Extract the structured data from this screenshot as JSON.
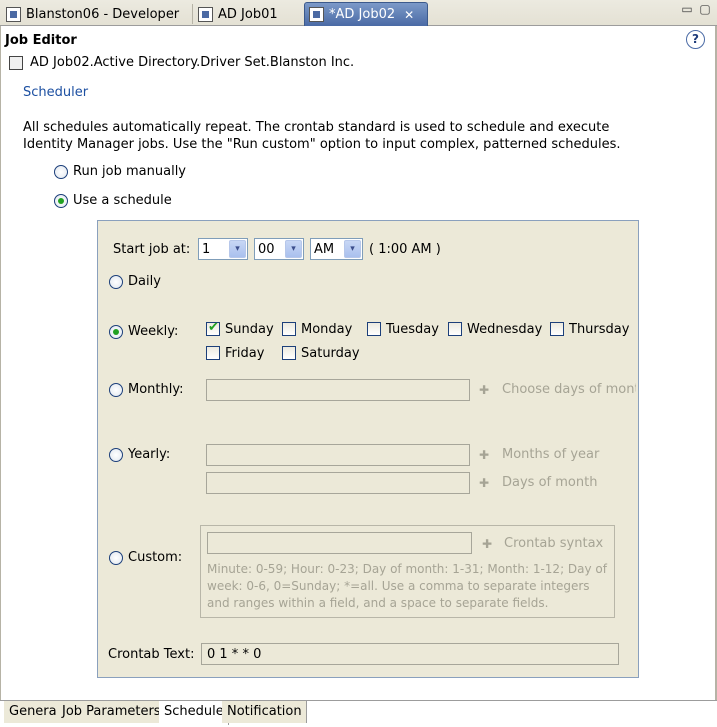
{
  "tabs": [
    {
      "label": "Blanston06 - Developer"
    },
    {
      "label": "AD Job01"
    },
    {
      "label": "*AD Job02",
      "active": true
    }
  ],
  "header": {
    "title": "Job Editor",
    "help_symbol": "?",
    "object_path": "AD Job02.Active Directory.Driver Set.Blanston Inc."
  },
  "section": {
    "link": "Scheduler",
    "description": "All schedules automatically repeat. The crontab standard is used to schedule and execute Identity Manager jobs. Use the \"Run custom\" option to input complex, patterned schedules."
  },
  "mode": {
    "run_manually": "Run job manually",
    "use_schedule": "Use a schedule",
    "selected": "use_schedule"
  },
  "schedule": {
    "start_label": "Start job at:",
    "hour": "1",
    "minute": "00",
    "ampm": "AM",
    "time_display": "( 1:00 AM )",
    "daily_label": "Daily",
    "weekly_label": "Weekly:",
    "monthly_label": "Monthly:",
    "yearly_label": "Yearly:",
    "custom_label": "Custom:",
    "selected": "weekly",
    "days": [
      {
        "label": "Sunday",
        "checked": true
      },
      {
        "label": "Monday",
        "checked": false
      },
      {
        "label": "Tuesday",
        "checked": false
      },
      {
        "label": "Wednesday",
        "checked": false
      },
      {
        "label": "Thursday",
        "checked": false
      },
      {
        "label": "Friday",
        "checked": false
      },
      {
        "label": "Saturday",
        "checked": false
      }
    ],
    "monthly_hint": "Choose days of mont",
    "yearly_months_hint": "Months of year",
    "yearly_days_hint": "Days of month",
    "crontab_syntax_hint": "Crontab syntax",
    "crontab_help": "Minute: 0-59; Hour: 0-23; Day of month: 1-31; Month: 1-12; Day of week: 0-6, 0=Sunday; *=all. Use a comma to separate integers and ranges within a field, and a space to separate fields.",
    "crontab_text_label": "Crontab Text:",
    "crontab_text_value": "0 1 * * 0"
  },
  "bottom_tabs": [
    {
      "label": "General"
    },
    {
      "label": "Job Parameters"
    },
    {
      "label": "Schedule",
      "active": true
    },
    {
      "label": "Notification"
    }
  ],
  "icons": {
    "dropdown": "▾",
    "plus": "✚",
    "close": "✕",
    "minimize": "▭",
    "maximize": "▢"
  }
}
